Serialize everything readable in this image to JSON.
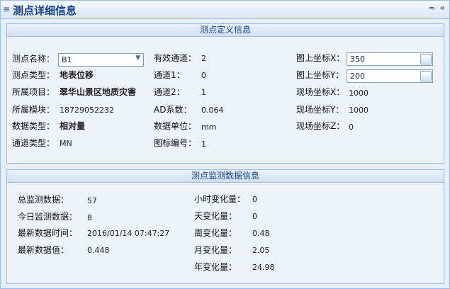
{
  "header": {
    "menu_icon": "≡",
    "title": "测点详细信息",
    "collapse_icon": "≈",
    "close_icon": "«"
  },
  "definition": {
    "legend": "测点定义信息",
    "point_name_label": "测点名称：",
    "point_name_value": "B1",
    "point_type_label": "测点类型：",
    "point_type_value": "地表位移",
    "project_label": "所属项目：",
    "project_value": "翠华山景区地质灾害",
    "module_label": "所属模块：",
    "module_value": "18729052232",
    "data_type_label": "数据类型：",
    "data_type_value": "相对量",
    "channel_type_label": "通道类型：",
    "channel_type_value": "MN",
    "valid_channel_label": "有效通道：",
    "valid_channel_value": "2",
    "channel1_label": "通道1：",
    "channel1_value": "0",
    "channel2_label": "通道2：",
    "channel2_value": "1",
    "ad_label": "AD系数：",
    "ad_value": "0.064",
    "unit_label": "数据单位：",
    "unit_value": "mm",
    "icon_no_label": "图标编号：",
    "icon_no_value": "1",
    "map_x_label": "图上坐标X：",
    "map_x_value": "350",
    "map_y_label": "图上坐标Y：",
    "map_y_value": "200",
    "site_x_label": "现场坐标X：",
    "site_x_value": "1000",
    "site_y_label": "现场坐标Y：",
    "site_y_value": "1000",
    "site_z_label": "现场坐标Z：",
    "site_z_value": "0"
  },
  "monitoring": {
    "legend": "测点监测数据信息",
    "total_label": "总监测数据：",
    "total_value": "57",
    "today_label": "今日监测数据：",
    "today_value": "8",
    "latest_time_label": "最新数据时间：",
    "latest_time_value": "2016/01/14 07:47:27",
    "latest_value_label": "最新数据值：",
    "latest_value_value": "0.448",
    "hour_label": "小时变化量：",
    "hour_value": "0",
    "day_label": "天变化量：",
    "day_value": "0",
    "week_label": "周变化量：",
    "week_value": "0.48",
    "month_label": "月变化量：",
    "month_value": "2.05",
    "year_label": "年变化量：",
    "year_value": "24.98"
  }
}
